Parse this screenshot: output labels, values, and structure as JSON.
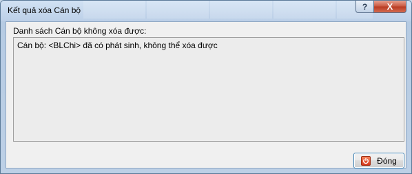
{
  "window": {
    "title": "Kết quả xóa Cán bộ",
    "help_label": "?",
    "close_label": "X"
  },
  "content": {
    "list_label": "Danh sách Cán bộ không xóa được:",
    "messages": [
      "Cán bộ: <BLChi> đã có phát sinh, không thể xóa được"
    ]
  },
  "footer": {
    "close_button_label": "Đóng"
  },
  "icons": {
    "help": "help-icon",
    "close": "close-icon",
    "close_button": "power-icon"
  },
  "colors": {
    "title_bar": "#c7d9ee",
    "close_control": "#c8553d",
    "content_bg": "#f0f0f0",
    "button_border": "#3c7fb1"
  }
}
